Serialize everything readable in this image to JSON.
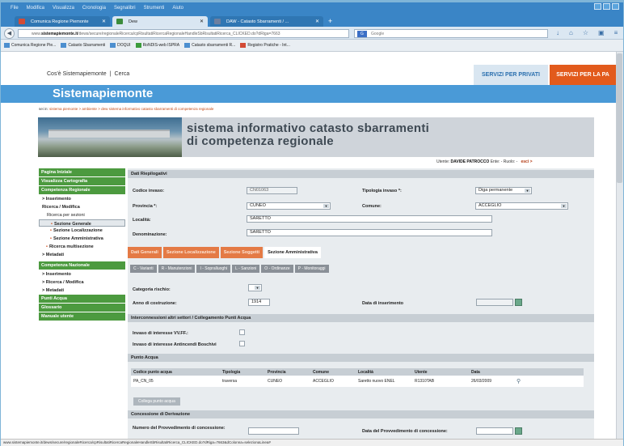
{
  "browser": {
    "menu": [
      "File",
      "Modifica",
      "Visualizza",
      "Cronologia",
      "Segnalibri",
      "Strumenti",
      "Aiuto"
    ],
    "tabs": [
      {
        "label": "Comunica Regione Piemonte",
        "active": false
      },
      {
        "label": "Dew",
        "active": true
      },
      {
        "label": "DAW - Catasto Sbarramenti / ...",
        "active": false
      }
    ],
    "url_prefix": "www.",
    "url_host": "sistemapiemonte.it",
    "url_rest": "/dews/secure/regionaleRicerca/cpRisultatiRicercaRegionaleHandleSbRisultatiRicerca_CLICKED.do?dRiga=7663",
    "search_placeholder": "Google",
    "search_engine": "G",
    "bookmarks": [
      "Comunica Regione Pie...",
      "Catasto Sbarramenti",
      "DOQUI",
      "RoNDIS-web ISPRA",
      "Catasto sbarramenti R...",
      "Registro Pratiche - Int..."
    ],
    "status_url": "www.sistemapiemonte.it/dews/secure/regionaleRicerca/cpRisultatiRicercaRegionaleHandleSbRisultatiRicerca_CLICKED.do?dRiga=7663&dColonna=selezionaLinea#"
  },
  "site": {
    "topnav": [
      "Cos'è Sistemapiemonte",
      "|",
      "Cerca"
    ],
    "btn_privati": "SERVIZI PER PRIVATI",
    "btn_pa": "SERVIZI PER LA PA",
    "brand": "Sistemapiemonte",
    "crumbs_prefix": "sei in:",
    "crumbs": "sistema piemonte > ambiente > dew sistema informativo catasto sbarramenti di competenza regionale",
    "banner_line1": "sistema informativo catasto sbarramenti",
    "banner_line2": "di competenza regionale",
    "user_label": "Utente:",
    "user_name": "DAVIDE PATROCCO",
    "user_role": "Ente: - Ruolo: -",
    "esci": "esci >"
  },
  "sidebar": [
    {
      "type": "hdr",
      "label": "Pagina Iniziale"
    },
    {
      "type": "hdr",
      "label": "Visualizza Cartografia"
    },
    {
      "type": "hdr",
      "label": "Competenza Regionale"
    },
    {
      "type": "b",
      "label": "> Inserimento"
    },
    {
      "type": "b",
      "label": "Ricerca / Modifica"
    },
    {
      "type": "i",
      "label": "Ricerca per sezioni"
    },
    {
      "type": "sel",
      "label": "Sezione Generale"
    },
    {
      "type": "sub",
      "label": "Sezione Localizzazione"
    },
    {
      "type": "sub",
      "label": "Sezione Amministrativa"
    },
    {
      "type": "b",
      "label": "Ricerca multisezione"
    },
    {
      "type": "b",
      "label": "> Metadati"
    },
    {
      "type": "hdr",
      "label": "Competenza Nazionale"
    },
    {
      "type": "b",
      "label": "> Inserimento"
    },
    {
      "type": "b",
      "label": "> Ricerca / Modifica"
    },
    {
      "type": "b",
      "label": "> Metadati"
    },
    {
      "type": "hdr",
      "label": "Punti Acqua"
    },
    {
      "type": "hdr",
      "label": "Glossario"
    },
    {
      "type": "hdr",
      "label": "Manuale utente"
    }
  ],
  "form": {
    "section_title": "Dati Riepilogativi",
    "codice_label": "Codice invaso:",
    "codice_value": "CN01063",
    "tipologia_label": "Tipologia invaso *:",
    "tipologia_value": "Diga permanente",
    "provincia_label": "Provincia *:",
    "provincia_value": "CUNEO",
    "comune_label": "Comune:",
    "comune_value": "ACCEGLIO",
    "localita_label": "Località:",
    "localita_value": "SARETTO",
    "denominazione_label": "Denominazione:",
    "denominazione_value": "SARETTO",
    "tabs": [
      "Dati Generali",
      "Sezione Localizzazione",
      "Sezione Soggetti",
      "Sezione Amministrativa"
    ],
    "subtabs": [
      "C - Varianti",
      "R - Manutenzioni",
      "I - Sopralluoghi",
      "L - Sanzioni",
      "O - Ordinanze",
      "P - Monitoraggi"
    ],
    "categoria_label": "Categoria rischio:",
    "anno_label": "Anno di costruzione:",
    "anno_value": "1914",
    "data_ins_label": "Data di inserimento",
    "interconn_title": "Interconnessioni altri settori / Collegamento Punti Acqua",
    "vvff_label": "Invaso di interesse VV.FF.:",
    "aib_label": "Invaso di interesse Antincendi Boschivi",
    "punto_title": "Punto Acqua",
    "table_headers": [
      "Codice punto acqua",
      "Tipologia",
      "Provincia",
      "Comune",
      "Località",
      "Utente",
      "Data"
    ],
    "table_rows": [
      [
        "PA_CN_05",
        "traversa",
        "CUNEO",
        "ACCEGLIO",
        "Saretto nuovo ENEL",
        "R1310TAB",
        "26/03/2009"
      ]
    ],
    "collega_label": "Collega punto acqua",
    "concessione_title": "Concessione di Derivazione",
    "numero_label": "Numero del Provvedimento di concessione:",
    "data_conc_label": "Data del Provvedimento di concessione:"
  }
}
